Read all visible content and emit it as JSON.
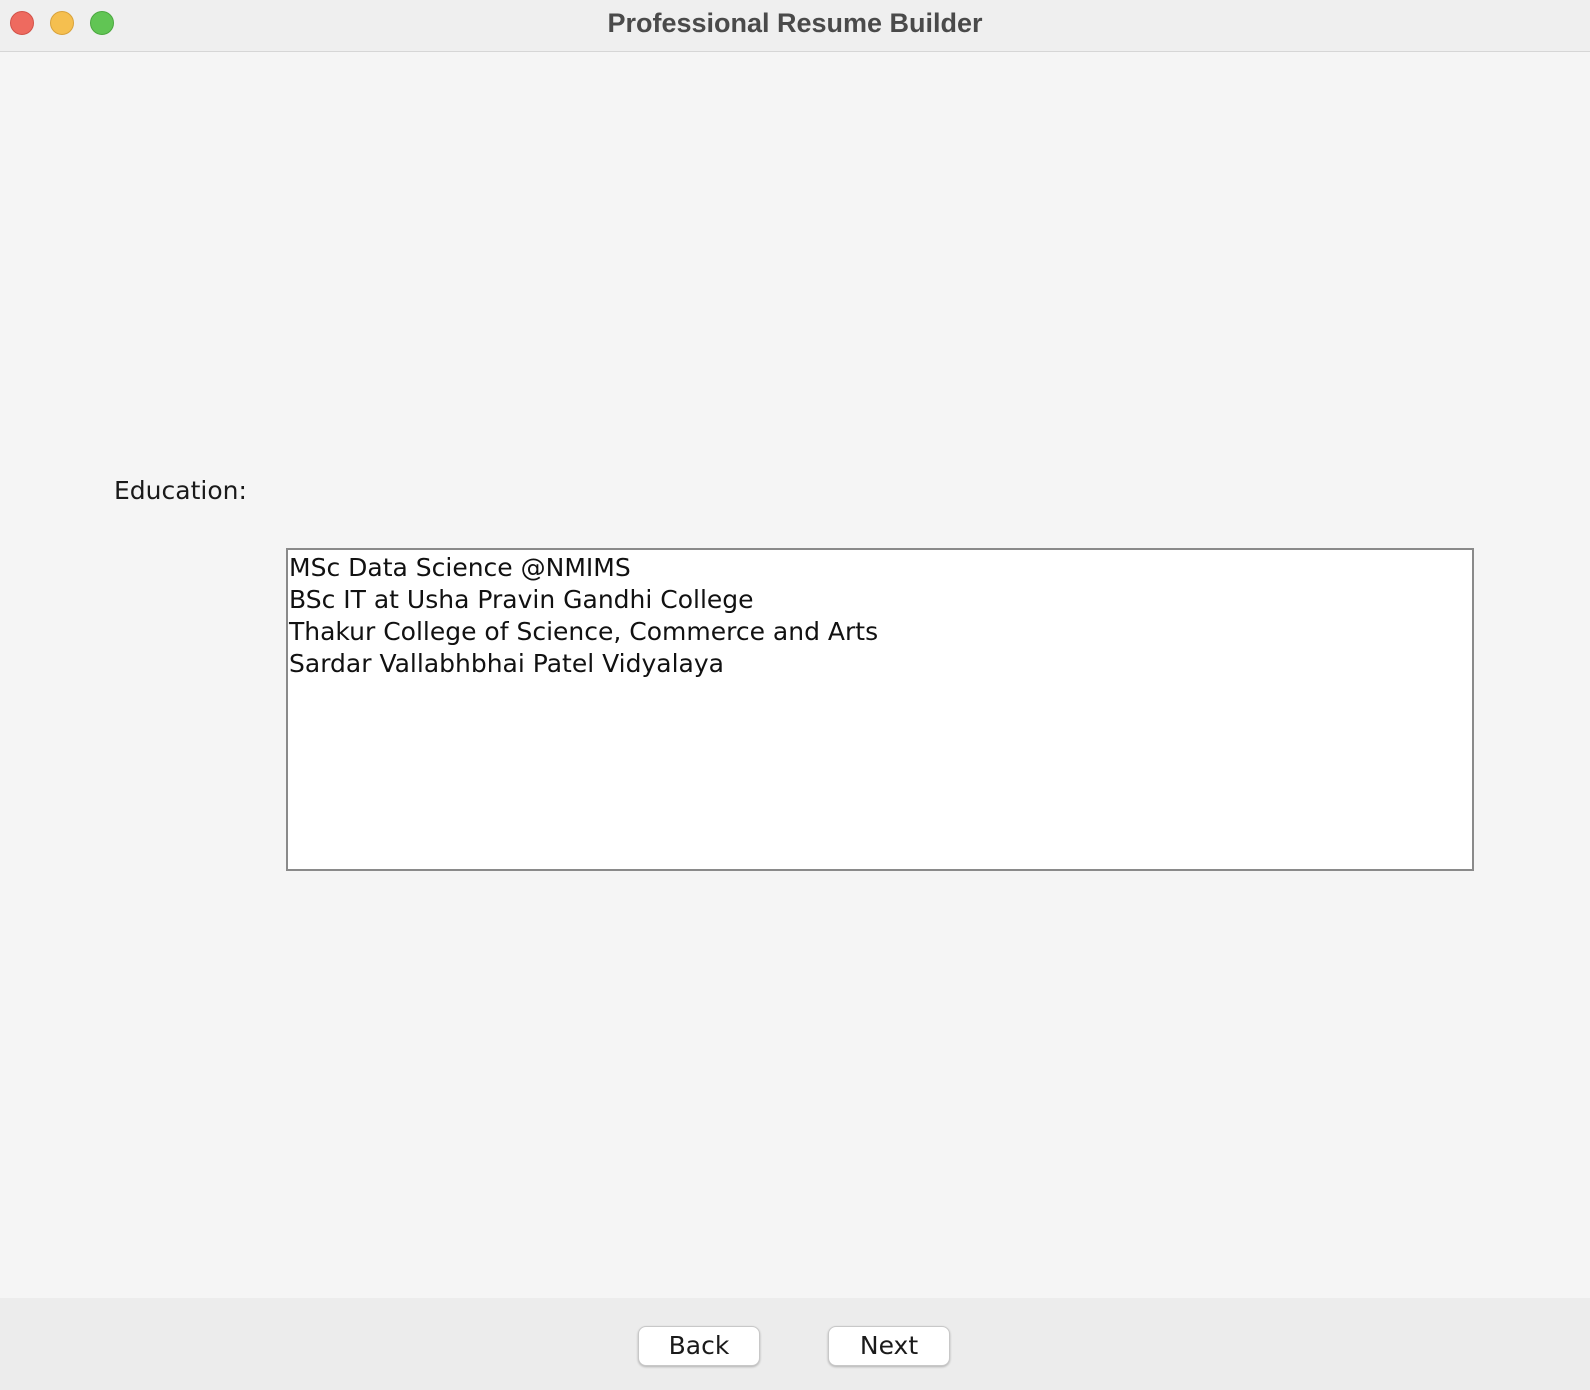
{
  "window": {
    "title": "Professional Resume Builder"
  },
  "form": {
    "education_label": "Education:",
    "education_lines": [
      "MSc Data Science @NMIMS",
      "BSc IT at Usha Pravin Gandhi College",
      "Thakur College of Science, Commerce and Arts",
      "Sardar Vallabhbhai Patel Vidyalaya"
    ]
  },
  "footer": {
    "back_label": "Back",
    "next_label": "Next"
  },
  "colors": {
    "close": "#ee6a5f",
    "minimize": "#f5bf4f",
    "maximize": "#61c554",
    "background": "#f5f5f5"
  }
}
